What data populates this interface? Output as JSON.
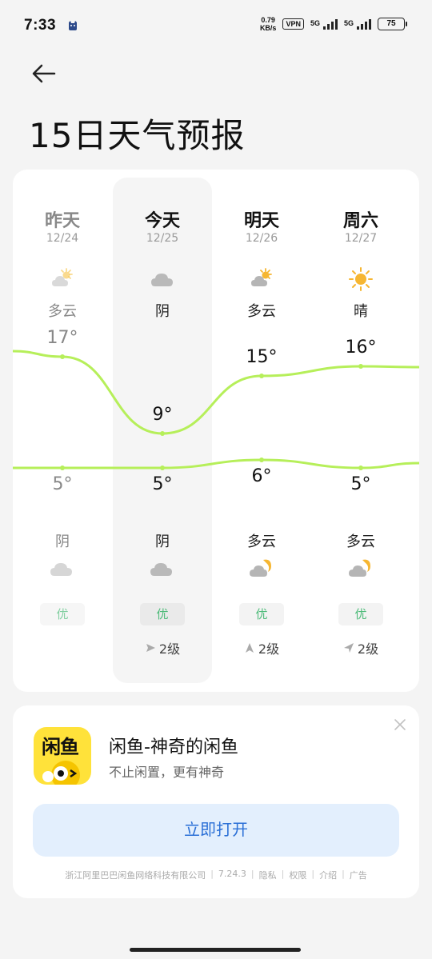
{
  "status": {
    "time": "7:33",
    "net_speed_value": "0.79",
    "net_speed_unit": "KB/s",
    "vpn": "VPN",
    "sim1": "5G",
    "sim2": "5G",
    "battery": "75"
  },
  "page": {
    "title": "15日天气预报"
  },
  "days": [
    {
      "name": "昨天",
      "date": "12/24",
      "day_cond": "多云",
      "day_icon": "partly-cloudy-day-icon",
      "high": "17°",
      "low": "5°",
      "night_cond": "阴",
      "night_icon": "overcast-icon",
      "aqi": "优",
      "wind": ""
    },
    {
      "name": "今天",
      "date": "12/25",
      "day_cond": "阴",
      "day_icon": "overcast-icon",
      "high": "9°",
      "low": "5°",
      "night_cond": "阴",
      "night_icon": "overcast-icon",
      "aqi": "优",
      "wind": "2级"
    },
    {
      "name": "明天",
      "date": "12/26",
      "day_cond": "多云",
      "day_icon": "partly-cloudy-day-icon",
      "high": "15°",
      "low": "6°",
      "night_cond": "多云",
      "night_icon": "partly-cloudy-night-icon",
      "aqi": "优",
      "wind": "2级"
    },
    {
      "name": "周六",
      "date": "12/27",
      "day_cond": "晴",
      "day_icon": "sunny-icon",
      "high": "16°",
      "low": "5°",
      "night_cond": "多云",
      "night_icon": "partly-cloudy-night-icon",
      "aqi": "优",
      "wind": "2级"
    }
  ],
  "chart_data": {
    "type": "line",
    "categories": [
      "12/24",
      "12/25",
      "12/26",
      "12/27"
    ],
    "series": [
      {
        "values": [
          17,
          9,
          15,
          16
        ]
      },
      {
        "values": [
          5,
          5,
          6,
          5
        ]
      }
    ]
  },
  "ad": {
    "logo_text": "闲鱼",
    "title": "闲鱼-神奇的闲鱼",
    "subtitle": "不止闲置，更有神奇",
    "button": "立即打开",
    "footer": {
      "company": "浙江阿里巴巴闲鱼网络科技有限公司",
      "version": "7.24.3",
      "privacy": "隐私",
      "permissions": "权限",
      "intro": "介绍",
      "ad_label": "广告"
    }
  },
  "colors": {
    "curve": "#b6ef5a",
    "aqi_green": "#4dbb79",
    "button_blue": "#2a6fd6",
    "logo_yellow": "#ffe23a"
  }
}
